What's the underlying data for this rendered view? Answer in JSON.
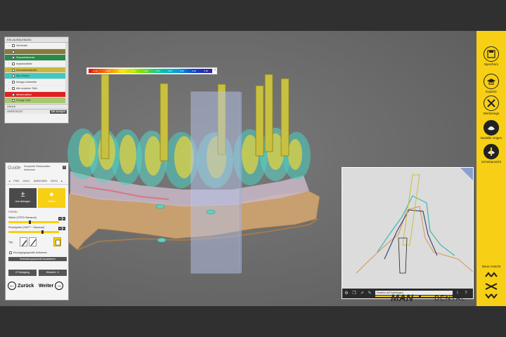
{
  "scale": {
    "ticks": [
      "-0.40",
      "-0.30",
      "-0.20",
      "-0.10",
      "0.00",
      "0.10",
      "0.20",
      "0.30",
      "0.40",
      "0.50"
    ]
  },
  "tree": {
    "header": "EIN-/AUSBLENDEN",
    "items": [
      {
        "label": "Verbinder",
        "color": "#f2f2f2"
      },
      {
        "label": "",
        "color": "#8a7a3a"
      },
      {
        "label": "Scanabutments",
        "color": "#2a8a4a"
      },
      {
        "label": "Implantatteile",
        "color": "#f2f2f2"
      },
      {
        "label": "Schraubenkanäle",
        "color": "#c8b840"
      },
      {
        "label": "Situ-Scans",
        "color": "#40c8c0"
      },
      {
        "label": "Design-Unterteile",
        "color": "#f2f2f2"
      },
      {
        "label": "Alle anderen Teile",
        "color": "#f2f2f2"
      },
      {
        "label": "Minderstärke",
        "color": "#e02020"
      },
      {
        "label": "Fertige Teile",
        "color": "#a8c870"
      }
    ],
    "zaehle": "ZÄHLE",
    "versteckt": "VERSTECKT",
    "show_all": "Alle anzeigen"
  },
  "guide": {
    "title": "Guide",
    "subtitle": "Komplette Restauration freiformen",
    "help": "?",
    "tabs": [
      "FREI",
      "AHUC",
      "ANPASSEN",
      "GESC"
    ],
    "btn_apply": "Auf-/abtragen",
    "btn_smooth": "Glätten",
    "pinsel": "PINSEL",
    "strength_label": "Stärke (STRG+Mausrad)",
    "size_label": "Pinselgröße (SHIFT + Mausrad)",
    "strength_value": 0.42,
    "size_value": 0.68,
    "typ": "Typ:",
    "checkbox": "Einzelgingivaprofile freiformen",
    "wide_btn": "Verbindersqueschnitt visualisieren",
    "undo": "Rückgäng.",
    "redo": "Wiederh.",
    "back": "Zurück",
    "next": "Weiter"
  },
  "toolbar": {
    "items": [
      {
        "label": "Speichern",
        "icon": "save-icon"
      },
      {
        "label": "Experte",
        "icon": "expert-icon"
      },
      {
        "label": "Werkzeuge",
        "icon": "tools-icon"
      },
      {
        "label": "Modelle zeigen",
        "icon": "model-icon"
      },
      {
        "label": "Schnittansicht",
        "icon": "section-icon"
      }
    ],
    "nav_label": "Neue Ansicht"
  },
  "inset": {
    "position_label": "Position auf Zahnbogen",
    "position_value": 0.58
  },
  "brand": {
    "part1": "MAN",
    "part2": "DENTAL"
  },
  "colors": {
    "accent": "#f7cf14",
    "background": "#2e2e2e",
    "viewport": "#6a6a6a"
  }
}
